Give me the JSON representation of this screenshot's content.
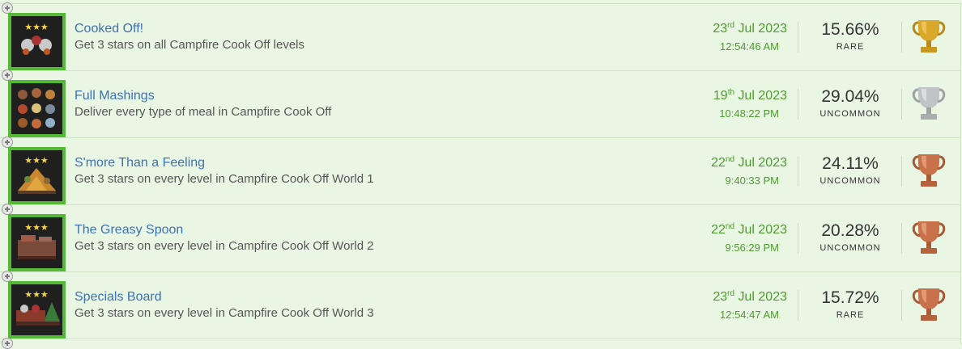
{
  "achievements": [
    {
      "title": "Cooked Off!",
      "description": "Get 3 stars on all Campfire Cook Off levels",
      "date_day": "23",
      "date_suffix": "rd",
      "date_rest": "Jul 2023",
      "time": "12:54:46 AM",
      "percent": "15.66%",
      "rarity": "RARE",
      "trophy": "gold-trophy-icon",
      "trophy_color": "#d9a82a"
    },
    {
      "title": "Full Mashings",
      "description": "Deliver every type of meal in Campfire Cook Off",
      "date_day": "19",
      "date_suffix": "th",
      "date_rest": "Jul 2023",
      "time": "10:48:22 PM",
      "percent": "29.04%",
      "rarity": "UNCOMMON",
      "trophy": "silver-trophy-icon",
      "trophy_color": "#bfc3c6"
    },
    {
      "title": "S'more Than a Feeling",
      "description": "Get 3 stars on every level in Campfire Cook Off World 1",
      "date_day": "22",
      "date_suffix": "nd",
      "date_rest": "Jul 2023",
      "time": "9:40:33 PM",
      "percent": "24.11%",
      "rarity": "UNCOMMON",
      "trophy": "bronze-trophy-icon",
      "trophy_color": "#c8714a"
    },
    {
      "title": "The Greasy Spoon",
      "description": "Get 3 stars on every level in Campfire Cook Off World 2",
      "date_day": "22",
      "date_suffix": "nd",
      "date_rest": "Jul 2023",
      "time": "9:56:29 PM",
      "percent": "20.28%",
      "rarity": "UNCOMMON",
      "trophy": "bronze-trophy-icon",
      "trophy_color": "#c8714a"
    },
    {
      "title": "Specials Board",
      "description": "Get 3 stars on every level in Campfire Cook Off World 3",
      "date_day": "23",
      "date_suffix": "rd",
      "date_rest": "Jul 2023",
      "time": "12:54:47 AM",
      "percent": "15.72%",
      "rarity": "RARE",
      "trophy": "bronze-trophy-icon",
      "trophy_color": "#c8714a"
    }
  ]
}
